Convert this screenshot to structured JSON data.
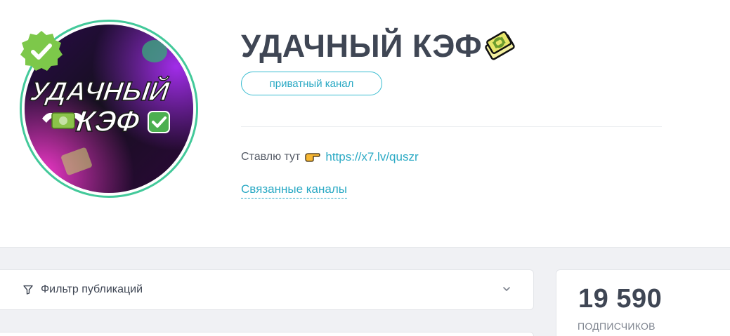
{
  "channel": {
    "title": "УДАЧНЫЙ КЭФ",
    "title_emoji_icon": "money-bills-emoji-icon",
    "type_pill": "приватный канал",
    "avatar": {
      "text_line1": "УДАЧНЫЙ",
      "text_line2": "КЭФ"
    },
    "verified": true
  },
  "description": {
    "prefix": "Ставлю тут",
    "pointer_icon": "pointing-right-icon",
    "link_text": "https://x7.lv/quszr"
  },
  "related_channels_label": "Связанные каналы",
  "filter": {
    "label": "Фильтр публикаций",
    "icon": "filter-funnel-icon",
    "chevron": "chevron-down-icon"
  },
  "stats": {
    "subscribers_value": "19 590",
    "subscribers_label": "ПОДПИСЧИКОВ"
  },
  "colors": {
    "accent": "#2aa9c4",
    "ring": "#43c99a",
    "badge": "#7dc84a",
    "title": "#3f4654",
    "background_lower": "#f0f1f4"
  }
}
